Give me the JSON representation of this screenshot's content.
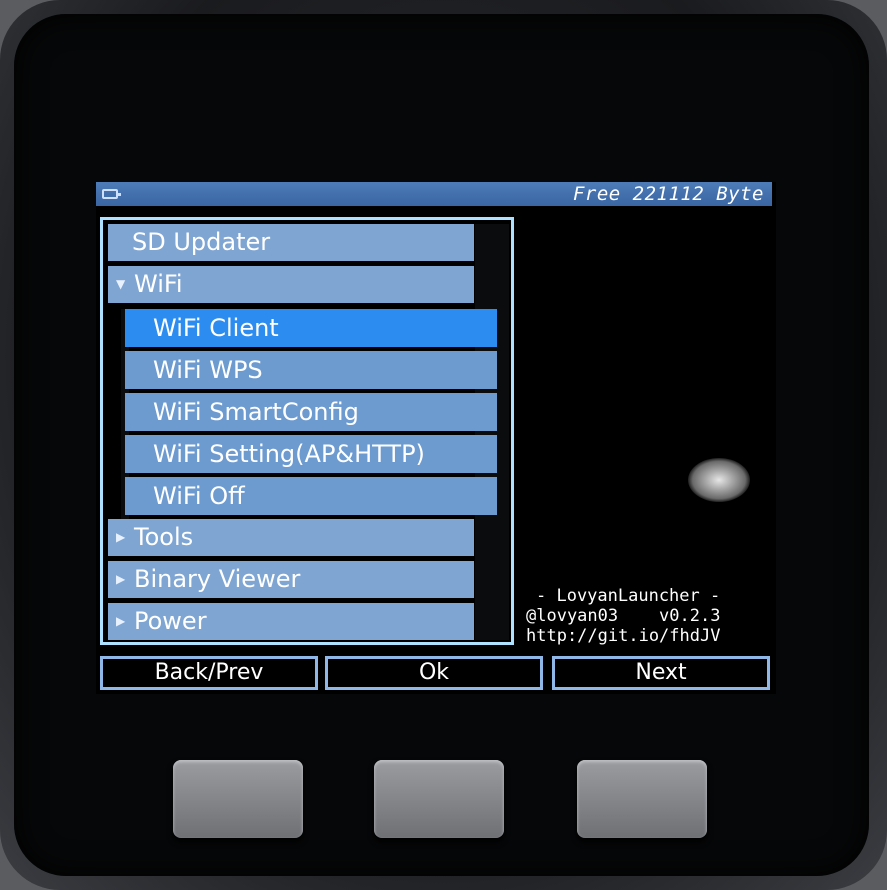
{
  "status_bar": {
    "battery": "battery-icon",
    "free_memory": "Free 221112 Byte"
  },
  "menu": {
    "items_top": [
      {
        "label": "SD Updater"
      },
      {
        "label": "WiFi",
        "indicator": "expanded"
      }
    ],
    "submenu": [
      {
        "label": "WiFi Client",
        "selected": true
      },
      {
        "label": "WiFi WPS"
      },
      {
        "label": "WiFi SmartConfig"
      },
      {
        "label": "WiFi Setting(AP&HTTP)"
      },
      {
        "label": "WiFi Off"
      }
    ],
    "items_bottom": [
      {
        "label": "Tools",
        "indicator": "collapsed"
      },
      {
        "label": "Binary Viewer",
        "indicator": "collapsed"
      },
      {
        "label": "Power",
        "indicator": "collapsed"
      }
    ]
  },
  "info": {
    "title": "- LovyanLauncher -",
    "author_version": "@lovyan03    v0.2.3",
    "url": "http://git.io/fhdJV"
  },
  "buttons": {
    "left": "Back/Prev",
    "center": "Ok",
    "right": "Next"
  },
  "colors": {
    "selected": "#2d8cf0",
    "item": "#7fa5d2",
    "frame": "#aee0ff"
  }
}
